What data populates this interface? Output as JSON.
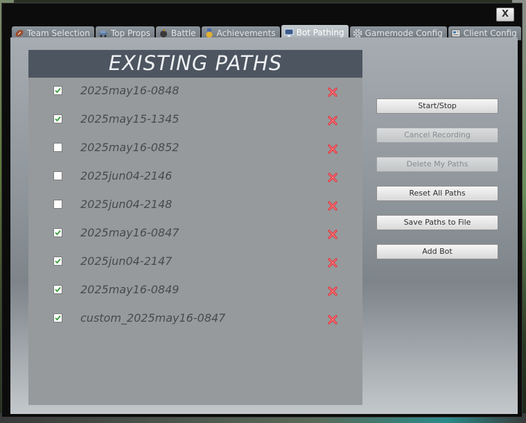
{
  "window": {
    "close_label": "X"
  },
  "tabs": [
    {
      "label": "Team Selection",
      "icon": "football-icon",
      "active": false
    },
    {
      "label": "Top Props",
      "icon": "car-icon",
      "active": false
    },
    {
      "label": "Battle",
      "icon": "bomb-icon",
      "active": false
    },
    {
      "label": "Achievements",
      "icon": "medal-icon",
      "active": false
    },
    {
      "label": "Bot Pathing",
      "icon": "monitor-icon",
      "active": true
    },
    {
      "label": "Gamemode Config",
      "icon": "gear-icon",
      "active": false
    },
    {
      "label": "Client Config",
      "icon": "config-icon",
      "active": false
    }
  ],
  "paths": {
    "title": "EXISTING PATHS",
    "items": [
      {
        "name": "2025may16-0848",
        "checked": true
      },
      {
        "name": "2025may15-1345",
        "checked": true
      },
      {
        "name": "2025may16-0852",
        "checked": false
      },
      {
        "name": "2025jun04-2146",
        "checked": false
      },
      {
        "name": "2025jun04-2148",
        "checked": false
      },
      {
        "name": "2025may16-0847",
        "checked": true
      },
      {
        "name": "2025jun04-2147",
        "checked": true
      },
      {
        "name": "2025may16-0849",
        "checked": true
      },
      {
        "name": "custom_2025may16-0847",
        "checked": true
      }
    ]
  },
  "actions": [
    {
      "label": "Start/Stop",
      "enabled": true
    },
    {
      "label": "Cancel Recording",
      "enabled": false
    },
    {
      "label": "Delete My Paths",
      "enabled": false
    },
    {
      "label": "Reset All Paths",
      "enabled": true
    },
    {
      "label": "Save Paths to File",
      "enabled": true
    },
    {
      "label": "Add Bot",
      "enabled": true
    }
  ],
  "colors": {
    "header_bg": "#4c5560",
    "delete_red": "#e0303a",
    "check_green": "#3a9a3a"
  }
}
